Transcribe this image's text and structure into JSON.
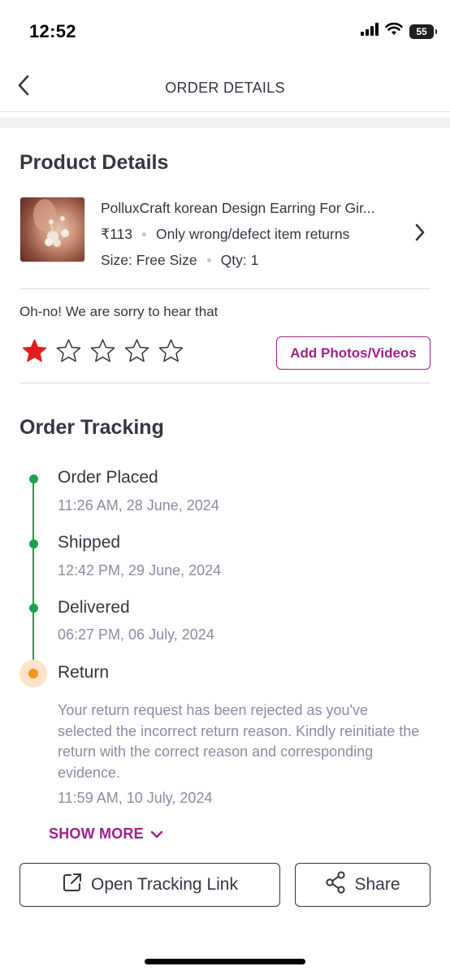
{
  "status_bar": {
    "time": "12:52",
    "battery": "55",
    "icons": [
      "signal-icon",
      "wifi-icon",
      "battery-icon"
    ]
  },
  "header": {
    "title": "ORDER DETAILS",
    "back_icon": "back-arrow-icon"
  },
  "product_details": {
    "title": "Product Details",
    "name": "PolluxCraft korean Design Earring For Gir...",
    "price": "₹113",
    "return_policy": "Only wrong/defect item returns",
    "size": "Size: Free Size",
    "qty": "Qty: 1"
  },
  "rating": {
    "message": "Oh-no! We are sorry to hear that",
    "stars_filled": 1,
    "stars_total": 5,
    "filled_color": "#e21c1c",
    "add_media_label": "Add Photos/Videos"
  },
  "order_tracking": {
    "title": "Order Tracking",
    "steps": [
      {
        "label": "Order Placed",
        "time": "11:26 AM, 28 June, 2024",
        "status": "done"
      },
      {
        "label": "Shipped",
        "time": "12:42 PM, 29 June, 2024",
        "status": "done"
      },
      {
        "label": "Delivered",
        "time": "06:27 PM, 06 July, 2024",
        "status": "done"
      },
      {
        "label": "Return",
        "description": "Your return request has been rejected as you've selected the incorrect return reason. Kindly reinitiate the return with the correct reason and corresponding evidence.",
        "time": "11:59 AM, 10 July, 2024",
        "status": "current"
      }
    ],
    "show_more_label": "SHOW MORE"
  },
  "actions": {
    "tracking_link_label": "Open Tracking Link",
    "share_label": "Share"
  },
  "colors": {
    "accent": "#9f2089",
    "success": "#1aa34a",
    "current": "#f7931e",
    "text": "#353543",
    "muted": "#8b8ba3"
  }
}
